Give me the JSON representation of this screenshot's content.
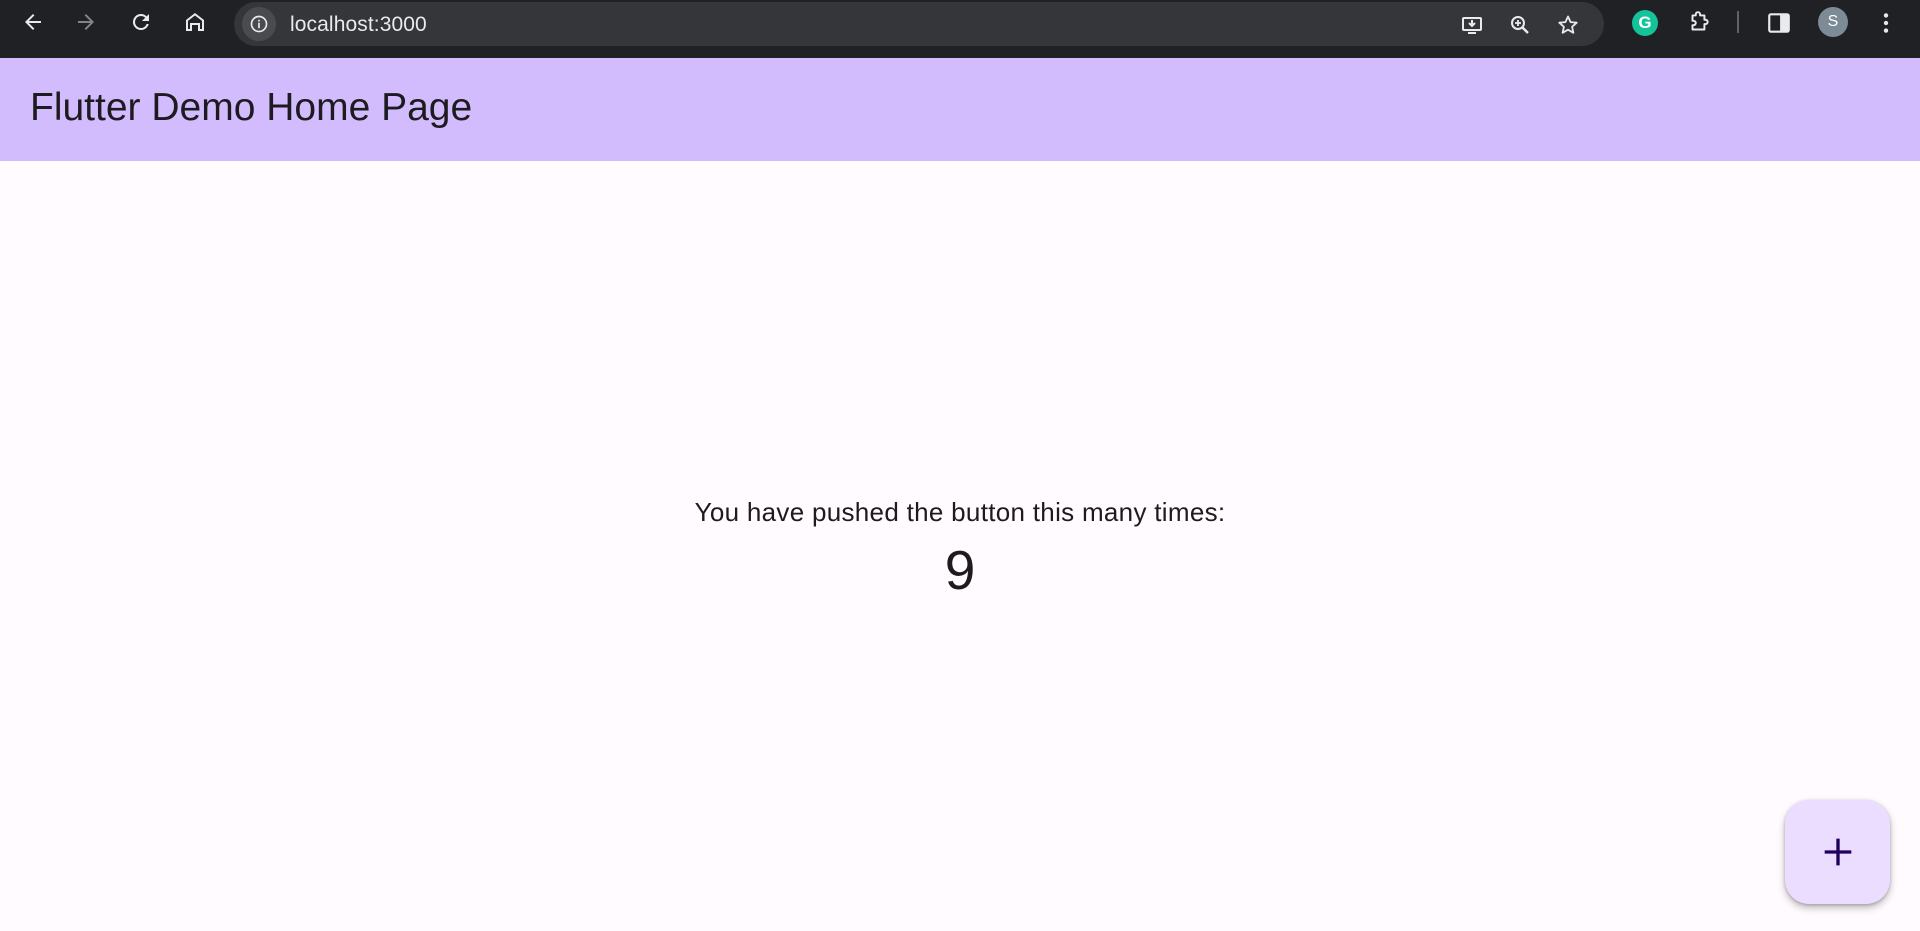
{
  "browser": {
    "url": "localhost:3000",
    "profile_initial": "S",
    "icons": {
      "back": "arrow-left-icon",
      "forward": "arrow-right-icon",
      "reload": "reload-icon",
      "home": "home-icon",
      "site_info": "info-icon",
      "install": "install-app-icon",
      "zoom": "zoom-icon",
      "bookmark": "star-icon",
      "grammarly": "grammarly-icon",
      "extensions": "puzzle-icon",
      "side_panel": "side-panel-icon",
      "menu": "kebab-menu-icon"
    }
  },
  "app_bar": {
    "title": "Flutter Demo Home Page"
  },
  "main": {
    "counter_label": "You have pushed the button this many times:",
    "counter_value": "9"
  },
  "fab": {
    "icon": "plus-icon"
  },
  "colors": {
    "app_bar_bg": "#d3bcfd",
    "body_bg": "#fffbfe",
    "fab_bg": "#eaddff",
    "fab_icon": "#21005d",
    "browser_bar_bg": "#202124"
  }
}
